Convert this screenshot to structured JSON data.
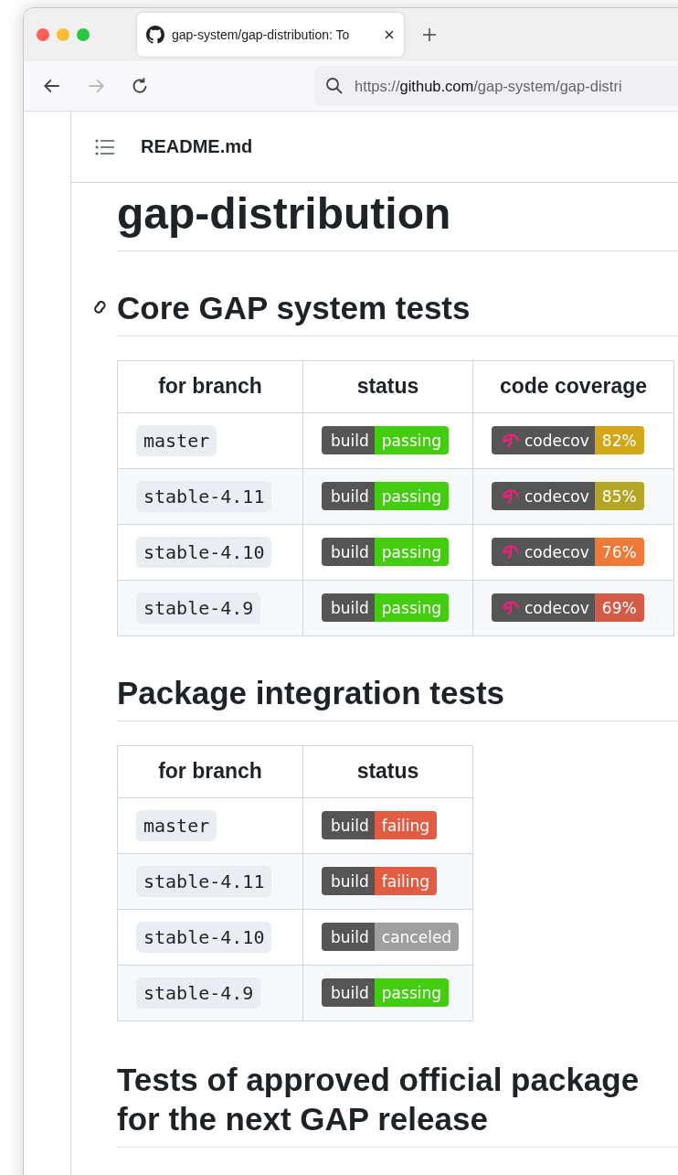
{
  "window": {
    "tab_title": "gap-system/gap-distribution: To",
    "url_host": "github.com",
    "url_prefix": "https://",
    "url_path": "/gap-system/gap-distri"
  },
  "readme": {
    "file": "README.md",
    "title": "gap-distribution"
  },
  "sections": [
    {
      "heading": "Core GAP system tests",
      "anchor": true,
      "columns": [
        "for branch",
        "status",
        "code coverage"
      ],
      "rows": [
        {
          "branch": "master",
          "badge": {
            "label": "build",
            "message": "passing",
            "kind": "passing"
          },
          "coverage": {
            "label": "codecov",
            "value": "82%",
            "color": "#d4a61a"
          }
        },
        {
          "branch": "stable-4.11",
          "badge": {
            "label": "build",
            "message": "passing",
            "kind": "passing"
          },
          "coverage": {
            "label": "codecov",
            "value": "85%",
            "color": "#b4a524"
          }
        },
        {
          "branch": "stable-4.10",
          "badge": {
            "label": "build",
            "message": "passing",
            "kind": "passing"
          },
          "coverage": {
            "label": "codecov",
            "value": "76%",
            "color": "#ef7a38"
          }
        },
        {
          "branch": "stable-4.9",
          "badge": {
            "label": "build",
            "message": "passing",
            "kind": "passing"
          },
          "coverage": {
            "label": "codecov",
            "value": "69%",
            "color": "#d65b46"
          }
        }
      ]
    },
    {
      "heading": "Package integration tests",
      "anchor": false,
      "columns": [
        "for branch",
        "status"
      ],
      "rows": [
        {
          "branch": "master",
          "badge": {
            "label": "build",
            "message": "failing",
            "kind": "failing"
          }
        },
        {
          "branch": "stable-4.11",
          "badge": {
            "label": "build",
            "message": "failing",
            "kind": "failing"
          }
        },
        {
          "branch": "stable-4.10",
          "badge": {
            "label": "build",
            "message": "canceled",
            "kind": "canceled"
          }
        },
        {
          "branch": "stable-4.9",
          "badge": {
            "label": "build",
            "message": "passing",
            "kind": "passing"
          }
        }
      ]
    }
  ],
  "last_heading": [
    "Tests of approved official package",
    "for the next GAP release"
  ]
}
